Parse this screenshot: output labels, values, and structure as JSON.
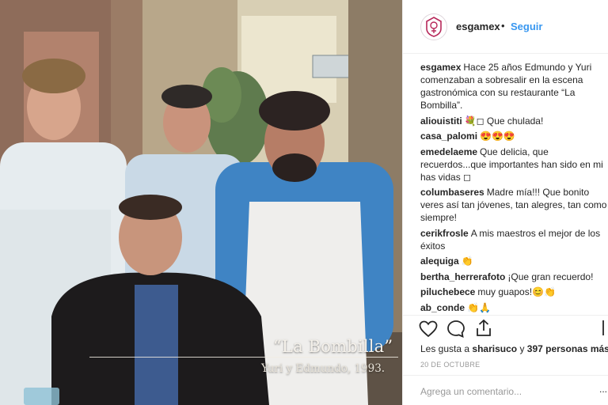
{
  "photo": {
    "caption_title": "“La Bombilla”",
    "caption_subtitle": "Yuri y Edmundo, 1993."
  },
  "header": {
    "username": "esgamex",
    "separator": "•",
    "follow_label": "Seguir"
  },
  "comments": [
    {
      "user": "esgamex",
      "text": "Hace 25 años Edmundo y Yuri comenzaban a sobresalir en la escena gastronómica con su restaurante “La Bombilla”."
    },
    {
      "user": "aliouistiti",
      "text": "💐◻ Que chulada!"
    },
    {
      "user": "casa_palomi",
      "text": "😍😍😍"
    },
    {
      "user": "emedelaeme",
      "text": "Que delicia, que recuerdos...que importantes han sido en mi has vidas ◻"
    },
    {
      "user": "columbaseres",
      "text": "Madre mía!!! Que bonito veres así tan jóvenes, tan alegres, tan como siempre!"
    },
    {
      "user": "cerikfrosle",
      "text": "A mis maestros el mejor de los éxitos"
    },
    {
      "user": "alequiga",
      "text": "👏"
    },
    {
      "user": "bertha_herrerafoto",
      "text": "¡Que gran recuerdo!"
    },
    {
      "user": "piluchebece",
      "text": "muy guapos!😊👏"
    },
    {
      "user": "ab_conde",
      "text": "👏🙏"
    }
  ],
  "likes": {
    "prefix": "Les gusta a",
    "user": "sharisuco",
    "connector": "y",
    "count_text": "397 personas más"
  },
  "date": "20 DE OCTUBRE",
  "add_comment": {
    "placeholder": "Agrega un comentario...",
    "more": "..."
  },
  "colors": {
    "link_blue": "#3897f0",
    "text": "#262626",
    "muted": "#999999",
    "divider": "#efefef"
  },
  "icons": [
    "heart-icon",
    "comment-icon",
    "share-icon",
    "bookmark-icon",
    "logo-icon"
  ]
}
